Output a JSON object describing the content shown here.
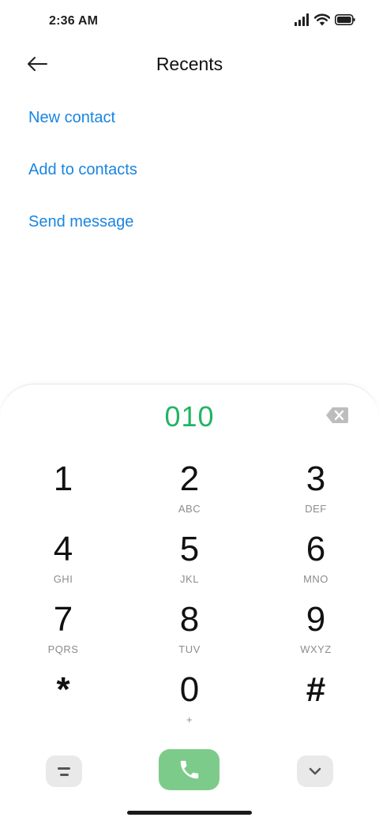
{
  "status_bar": {
    "time": "2:36 AM",
    "icons": [
      "signal-icon",
      "wifi-icon",
      "battery-icon"
    ]
  },
  "header": {
    "title": "Recents",
    "back_icon": "arrow-left-icon"
  },
  "actions": {
    "new_contact": "New contact",
    "add_to_contacts": "Add to contacts",
    "send_message": "Send message"
  },
  "dialer": {
    "number": "010",
    "backspace_icon": "backspace-icon",
    "keys": [
      {
        "digit": "1",
        "letters": ""
      },
      {
        "digit": "2",
        "letters": "ABC"
      },
      {
        "digit": "3",
        "letters": "DEF"
      },
      {
        "digit": "4",
        "letters": "GHI"
      },
      {
        "digit": "5",
        "letters": "JKL"
      },
      {
        "digit": "6",
        "letters": "MNO"
      },
      {
        "digit": "7",
        "letters": "PQRS"
      },
      {
        "digit": "8",
        "letters": "TUV"
      },
      {
        "digit": "9",
        "letters": "WXYZ"
      },
      {
        "digit": "*",
        "letters": ""
      },
      {
        "digit": "0",
        "letters": "+"
      },
      {
        "digit": "#",
        "letters": ""
      }
    ]
  },
  "controls": {
    "menu_icon": "menu-icon",
    "call_icon": "phone-icon",
    "collapse_icon": "chevron-down-icon"
  },
  "colors": {
    "accent_link": "#1a85e0",
    "number_green": "#22b463",
    "call_button": "#7dcb8a",
    "control_bg": "#e9e9e9"
  }
}
